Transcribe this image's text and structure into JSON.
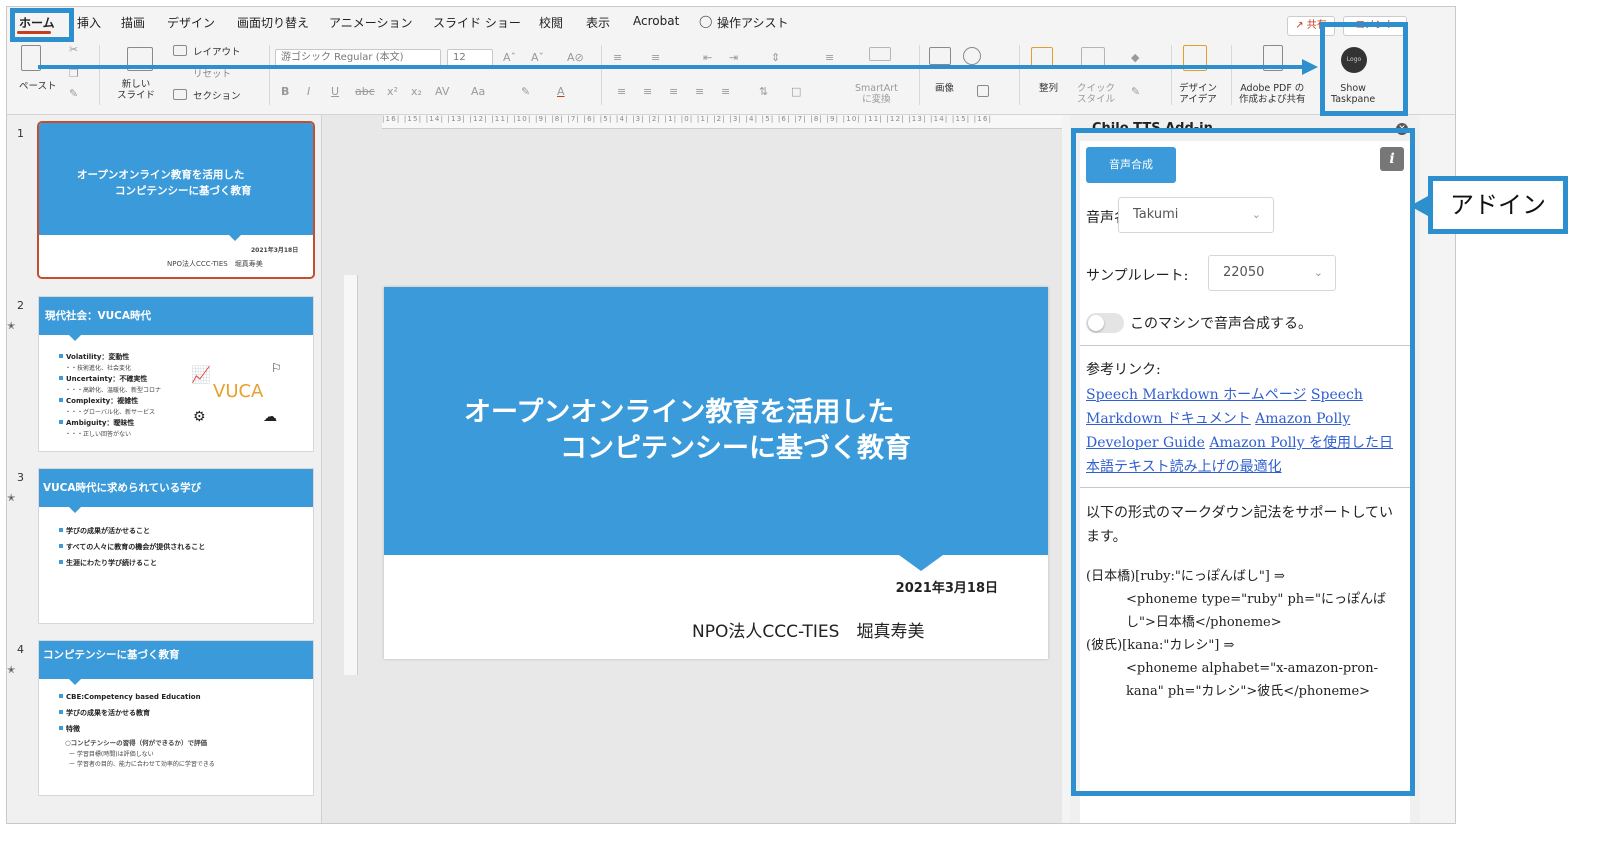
{
  "menu": {
    "tabs": [
      "ホーム",
      "挿入",
      "描画",
      "デザイン",
      "画面切り替え",
      "アニメーション",
      "スライド ショー",
      "校閲",
      "表示",
      "Acrobat",
      "操作アシスト"
    ],
    "share_label": "共有",
    "comment_label": "コメント"
  },
  "ribbon": {
    "paste": "ペースト",
    "new_slide": "新しい\nスライド",
    "layout": "レイアウト",
    "reset": "リセット",
    "section": "セクション",
    "font_name": "游ゴシック Regular (本文)",
    "font_size": "12",
    "smartart": "SmartArt\nに変換",
    "picture": "画像",
    "arrange": "整列",
    "quick_styles": "クイック\nスタイル",
    "design_ideas": "デザイン\nアイデア",
    "adobe_pdf": "Adobe PDF の\n作成および共有",
    "show_taskpane": "Show\nTaskpane",
    "logo_text": "Logo"
  },
  "thumbnails": [
    {
      "num": "1",
      "title1": "オープンオンライン教育を活用した",
      "title2": "コンピテンシーに基づく教育",
      "date": "2021年3月18日",
      "author": "NPO法人CCC-TIES　堀真寿美"
    },
    {
      "num": "2",
      "title": "現代社会：VUCA時代",
      "bullets": [
        {
          "head": "Volatility：変動性",
          "sub": "・・技術進化、社会変化"
        },
        {
          "head": "Uncertainty：不確実性",
          "sub": "・・・高齢化、温暖化、新型コロナ"
        },
        {
          "head": "Complexity：複雑性",
          "sub": "・・・グローバル化、新サービス"
        },
        {
          "head": "Ambiguity：曖昧性",
          "sub": "・・・正しい回答がない"
        }
      ],
      "graphic_text": "VUCA"
    },
    {
      "num": "3",
      "title": "VUCA時代に求められている学び",
      "bullets": [
        "学びの成果が活かせること",
        "すべての人々に教育の機会が提供されること",
        "生涯にわたり学び続けること"
      ]
    },
    {
      "num": "4",
      "title": "コンピテンシーに基づく教育",
      "bullets": [
        "CBE:Competency based Education",
        "学びの成果を活かせる教育",
        "特徴"
      ],
      "subs": [
        "○コンピテンシーの習得（何ができるか）で評価",
        "ー 学習目標(時間)は評価しない",
        "ー 学習者の目的、能力に合わせて効率的に学習できる"
      ]
    }
  ],
  "slide": {
    "title_line1": "オープンオンライン教育を活用した",
    "title_line2": "コンピテンシーに基づく教育",
    "date": "2021年3月18日",
    "author": "NPO法人CCC-TIES　堀真寿美"
  },
  "ruler": {
    "h_ticks": "|16| |15| |14| |13| |12| |11| |10| |9| |8| |7| |6| |5| |4| |3| |2| |1| |0| |1| |2| |3| |4| |5| |6| |7| |8| |9| |10| |11| |12| |13| |14| |15| |16|"
  },
  "taskpane": {
    "title": "Chilo TTS Add-in",
    "synthesize_button": "音声合成",
    "info_icon": "i",
    "voice_label": "音声名:",
    "voice_value": "Takumi",
    "sample_rate_label": "サンプルレート:",
    "sample_rate_value": "22050",
    "local_toggle_label": "このマシンで音声合成する。",
    "ref_label": "参考リンク:",
    "links": [
      "Speech Markdown ホームページ",
      "Speech Markdown ドキュメント",
      "Amazon Polly Developer Guide",
      "Amazon Polly を使用した日本語テキスト読み上げの最適化"
    ],
    "markdown_desc": "以下の形式のマークダウン記法をサポートしています。",
    "example1_src": "(日本橋)[ruby:\"にっぽんばし\"] ⇒",
    "example1_out": "<phoneme type=\"ruby\" ph=\"にっぽんばし\">日本橋</phoneme>",
    "example2_src": "(彼氏)[kana:\"カレシ\"] ⇒",
    "example2_out": "<phoneme alphabet=\"x-amazon-pron-kana\" ph=\"カレシ\">彼氏</phoneme>"
  },
  "annotation": {
    "callout_text": "アドイン",
    "color": "#2e8fcf"
  },
  "colors": {
    "accent_blue": "#3b9ad9",
    "office_red": "#c43e1c",
    "link": "#2f5fd0"
  }
}
